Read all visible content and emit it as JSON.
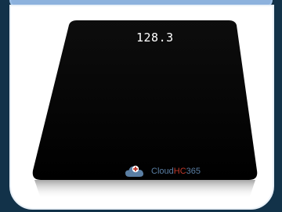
{
  "header": {
    "title": ""
  },
  "scale": {
    "display_value": "128.3"
  },
  "brand": {
    "prefix": "Cloud",
    "middle": "HC",
    "suffix": "365"
  },
  "colors": {
    "background": "#123249",
    "header": "#8db2dd",
    "card": "#ffffff",
    "scale": "#050505",
    "brand": "#5a7ea3",
    "brand_accent": "#c0392b"
  }
}
